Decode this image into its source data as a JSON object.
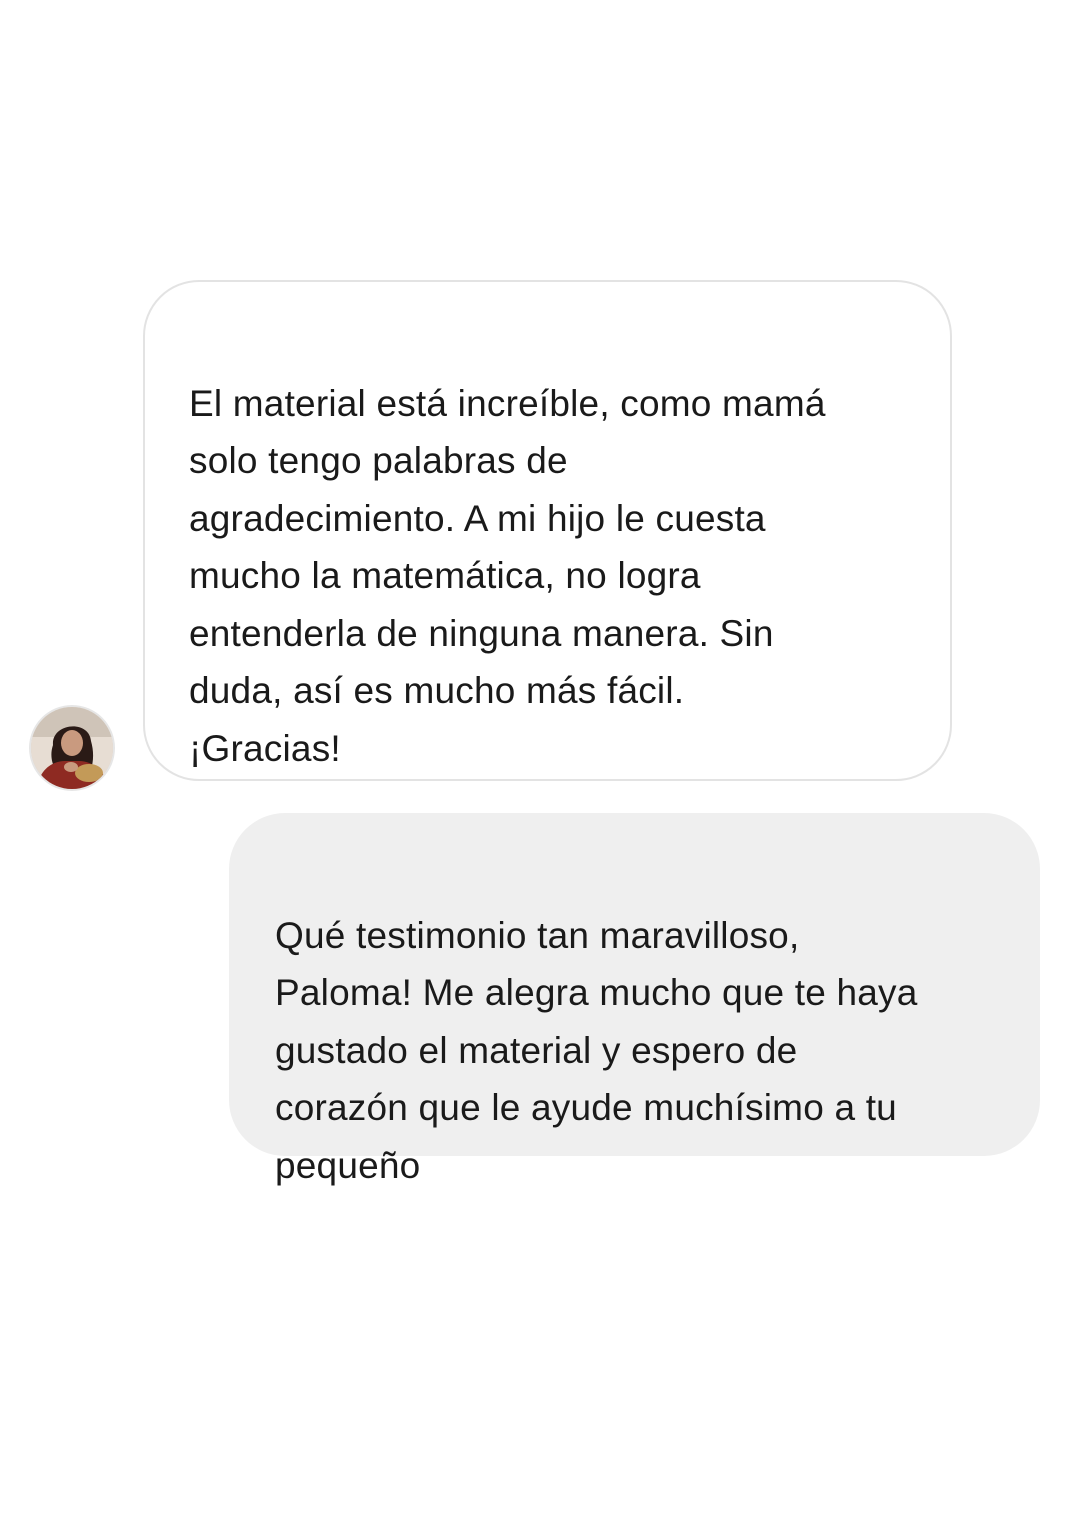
{
  "chat": {
    "incoming": {
      "text": "El material está increíble, como mamá\nsolo tengo palabras de\nagradecimiento. A mi hijo le cuesta\nmucho la matemática, no logra\nentenderla de ninguna manera. Sin\nduda, así es mucho más fácil.\n¡Gracias!",
      "avatar": "contact-avatar-photo"
    },
    "outgoing": {
      "text": "Qué testimonio tan maravilloso,\nPaloma! Me alegra mucho que te haya\ngustado el material y espero de\ncorazón que le ayude muchísimo a tu\npequeño"
    }
  },
  "colors": {
    "background": "#ffffff",
    "incoming_bubble": "#ffffff",
    "incoming_border": "#e3e3e3",
    "outgoing_bubble": "#efefef",
    "text": "#1a1a1a"
  }
}
